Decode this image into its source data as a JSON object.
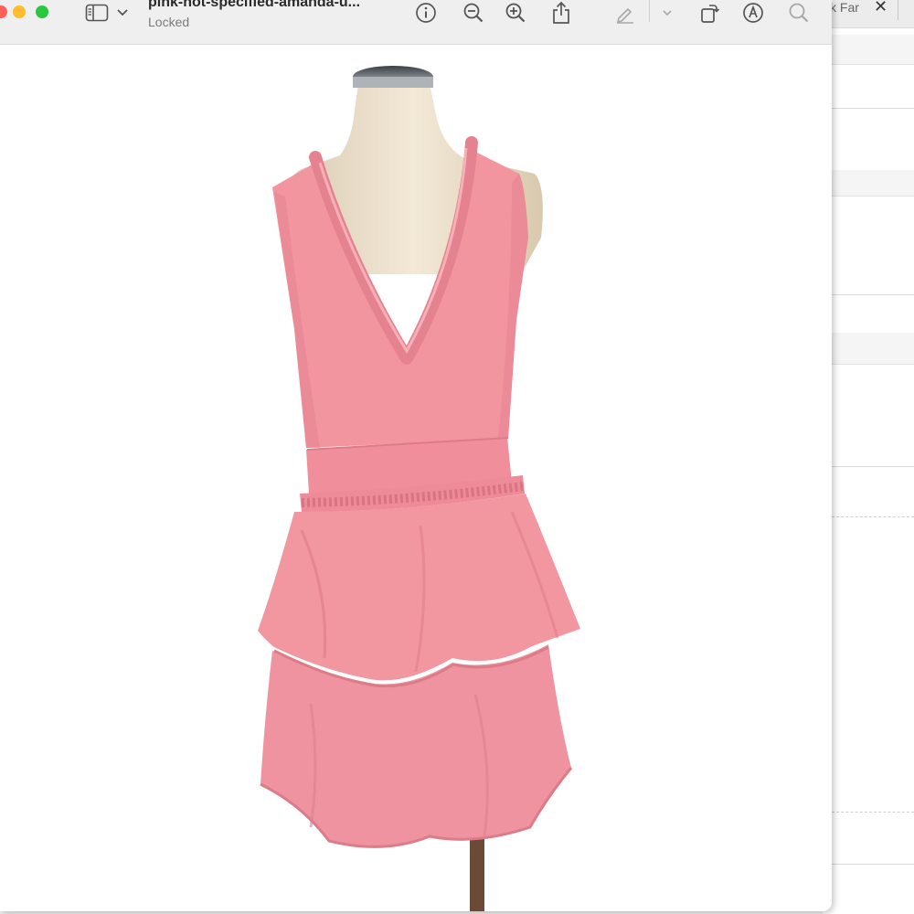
{
  "window": {
    "title": "pink-not-specified-amanda-u...",
    "subtitle": "Locked"
  },
  "background_browser": {
    "tab_title": "k Far"
  },
  "toolbar": {
    "buttons": [
      "sidebar-toggle",
      "info",
      "zoom-out",
      "zoom-in",
      "share",
      "markup",
      "rotate",
      "annotate",
      "search"
    ]
  },
  "image": {
    "subject": "pink sleeveless tiered ruffle dress on mannequin",
    "colors": {
      "dress": "#f2959f",
      "dress_shadow": "#de7d89",
      "mannequin": "#f1e6d2",
      "stand": "#6b4a36"
    }
  }
}
